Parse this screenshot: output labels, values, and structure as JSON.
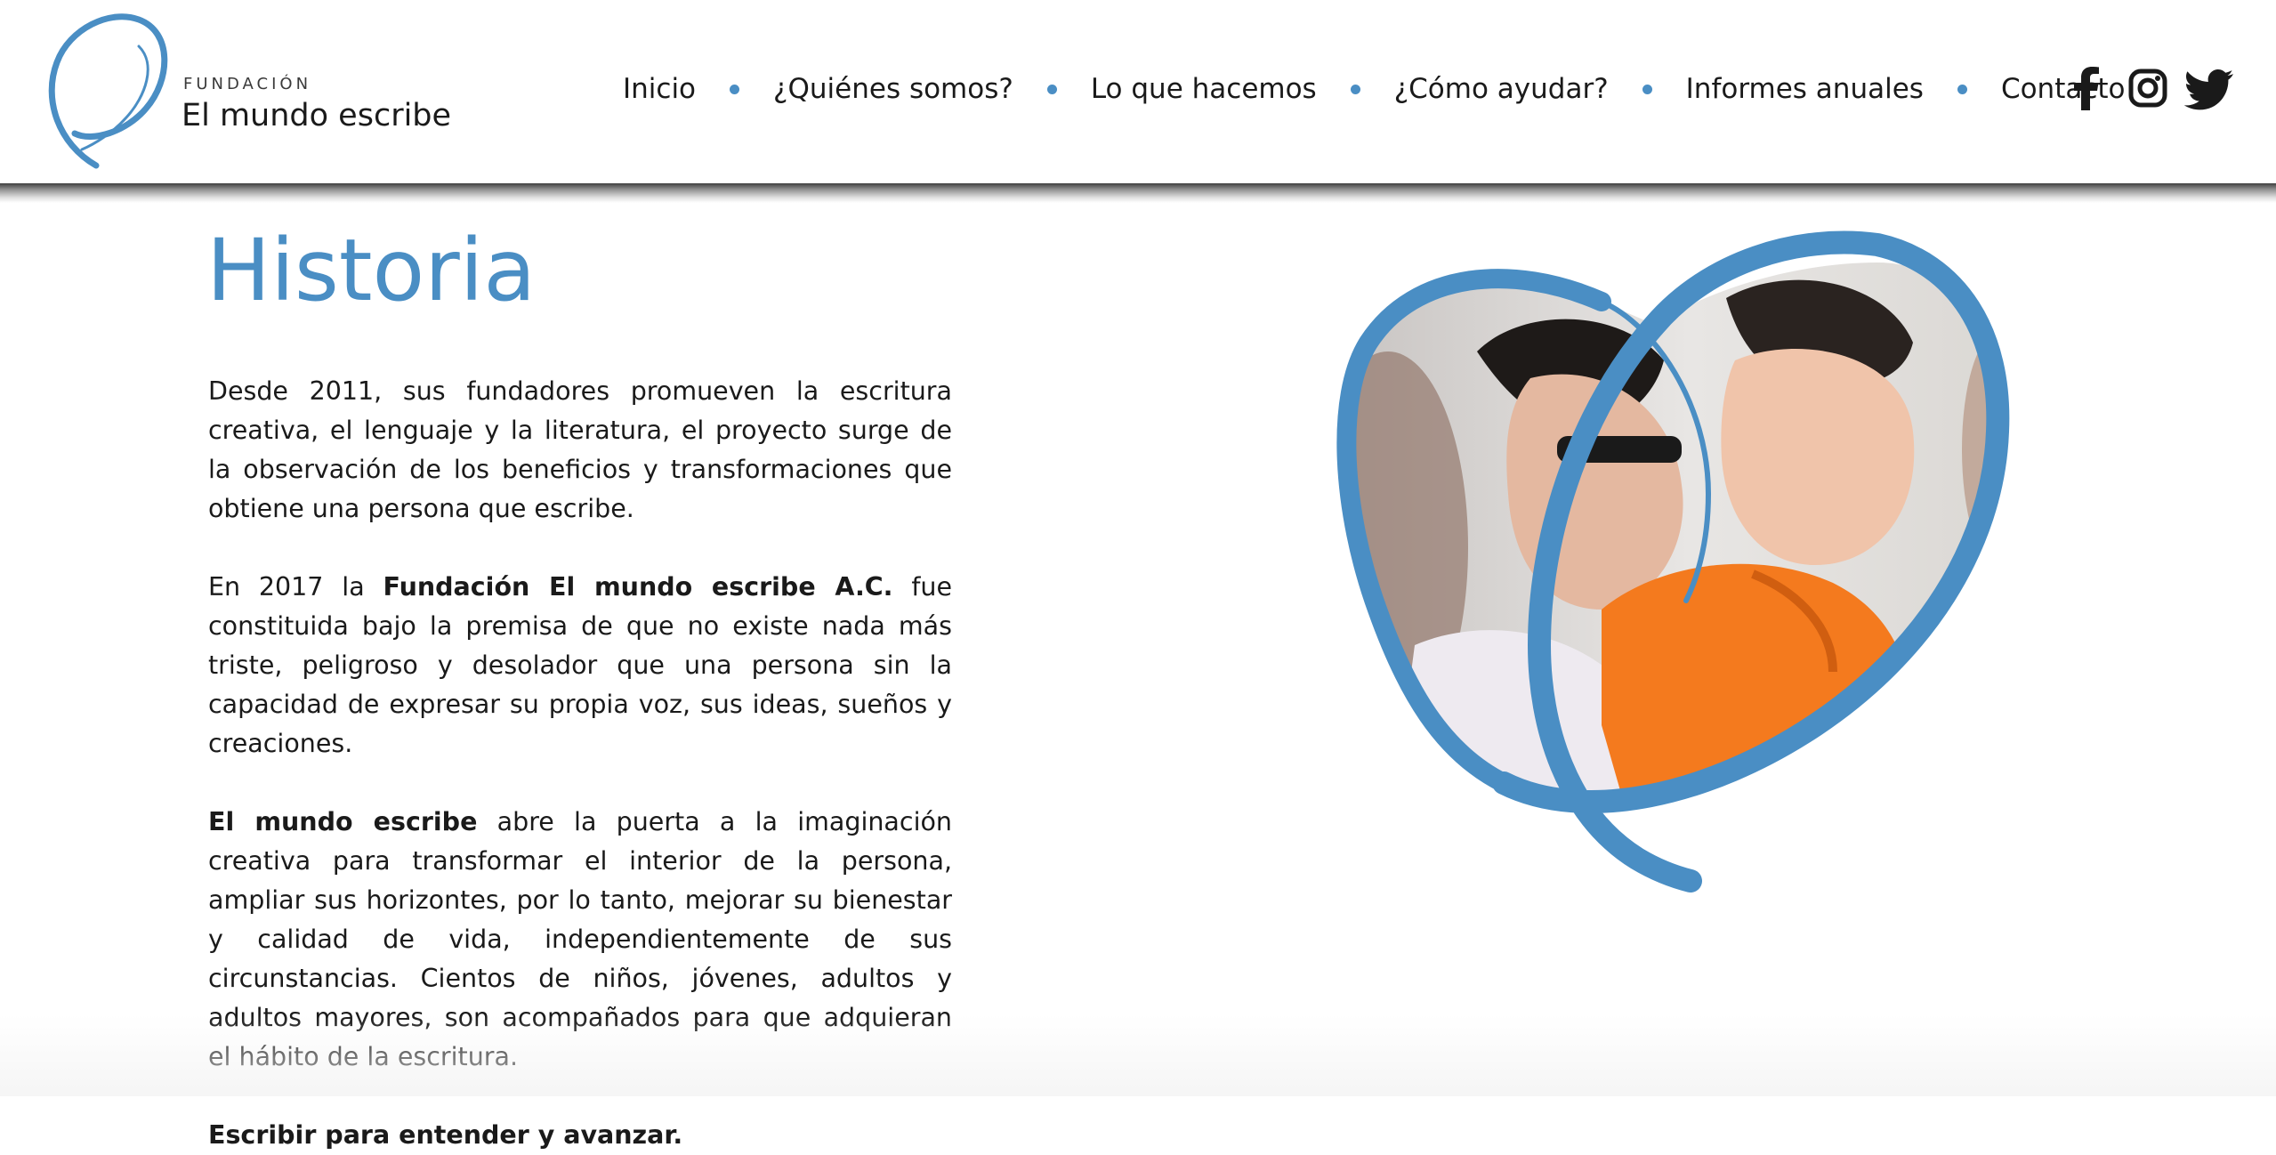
{
  "header": {
    "logo": {
      "small": "FUNDACIÓN",
      "main": "El mundo escribe"
    },
    "nav": [
      {
        "label": "Inicio"
      },
      {
        "label": "¿Quiénes somos?"
      },
      {
        "label": "Lo que hacemos"
      },
      {
        "label": "¿Cómo ayudar?"
      },
      {
        "label": "Informes anuales"
      },
      {
        "label": "Contacto"
      }
    ],
    "social": [
      "facebook-icon",
      "instagram-icon",
      "twitter-icon"
    ]
  },
  "main": {
    "title": "Historia",
    "p1": "Desde 2011, sus fundadores promueven la escritura creativa, el lenguaje y la literatura, el proyecto surge de la observación de los beneficios y transformaciones que obtiene una persona que escribe.",
    "p2_before": "En 2017 la ",
    "p2_bold": "Fundación El mundo escribe A.C.",
    "p2_after": " fue constituida bajo la premisa de que no existe nada más triste, peligroso y desolador que una persona sin la capacidad de expresar su propia voz, sus ideas, sueños y creaciones.",
    "p3_bold": "El mundo escribe",
    "p3_after": " abre la puerta a la imaginación creativa para transformar el interior de la persona, ampliar sus horizontes, por lo tanto, mejorar su bienestar y calidad de vida, independientemente de sus circunstancias. Cientos de niños, jóvenes, adultos y adultos mayores, son acompañados para que adquieran el hábito de la escritura.",
    "tagline": "Escribir para entender y avanzar."
  },
  "colors": {
    "accent": "#4a8ec4",
    "text": "#1a1a1a",
    "background": "#ffffff"
  }
}
